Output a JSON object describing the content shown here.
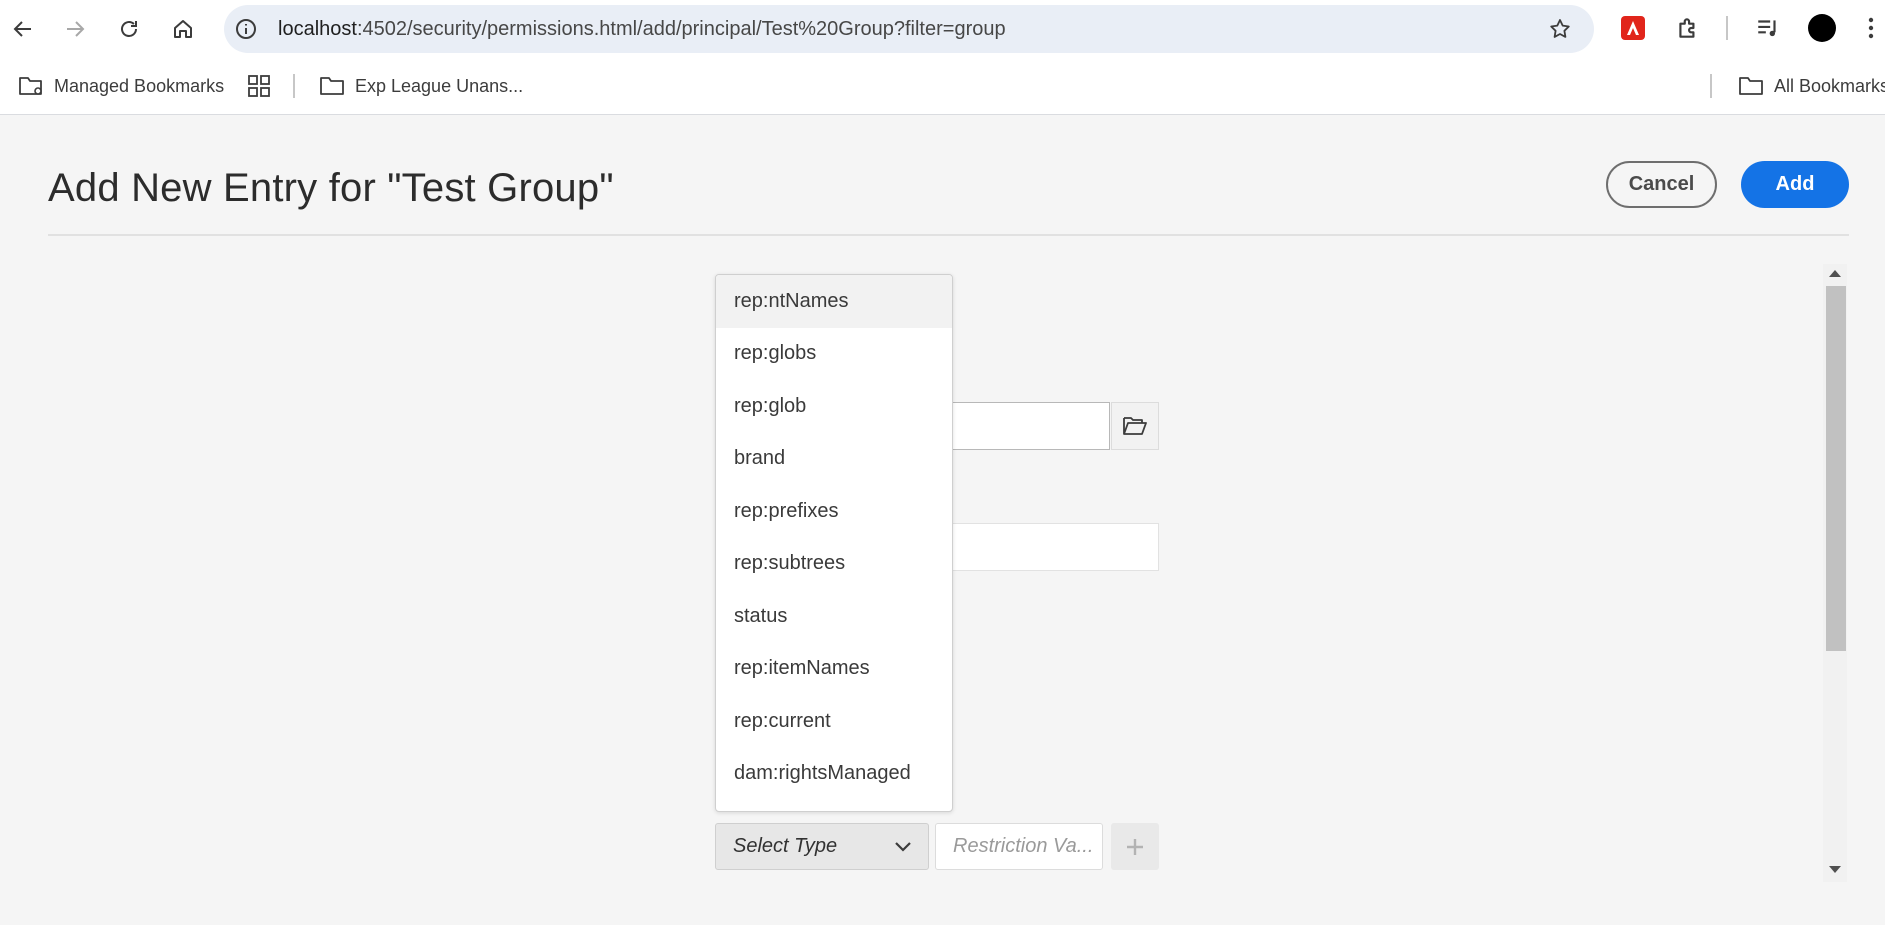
{
  "browser": {
    "url_host": "localhost",
    "url_rest": ":4502/security/permissions.html/add/principal/Test%20Group?filter=group"
  },
  "bookmarks": {
    "managed": "Managed Bookmarks",
    "exp_league": "Exp League Unans...",
    "all": "All Bookmarks"
  },
  "page": {
    "title": "Add New Entry for \"Test Group\"",
    "cancel_label": "Cancel",
    "add_label": "Add"
  },
  "restriction": {
    "select_type_value": "Select Type",
    "value_placeholder": "Restriction Va...",
    "options": [
      "rep:ntNames",
      "rep:globs",
      "rep:glob",
      "brand",
      "rep:prefixes",
      "rep:subtrees",
      "status",
      "rep:itemNames",
      "rep:current",
      "dam:rightsManaged"
    ]
  },
  "colors": {
    "accent": "#1473e6",
    "page_bg": "#f5f5f5",
    "omnibox_bg": "#e9eef6"
  }
}
